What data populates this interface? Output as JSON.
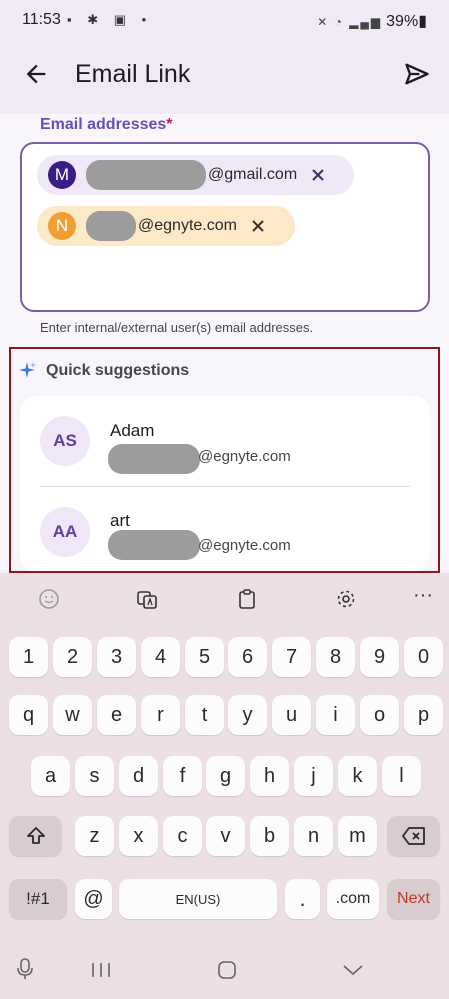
{
  "status": {
    "time": "11:53",
    "battery": "39%"
  },
  "appbar": {
    "title": "Email Link"
  },
  "field": {
    "label": "Email addresses",
    "required": "*",
    "helper": "Enter internal/external user(s) email addresses."
  },
  "chips": [
    {
      "initial": "M",
      "domain": "@gmail.com"
    },
    {
      "initial": "N",
      "domain": "@egnyte.com"
    }
  ],
  "suggestions": {
    "title": "Quick suggestions",
    "items": [
      {
        "initials": "AS",
        "name": "Adam",
        "domain": "@egnyte.com"
      },
      {
        "initials": "AA",
        "name": "art",
        "domain": "@egnyte.com"
      }
    ]
  },
  "keyboard": {
    "numbers": [
      "1",
      "2",
      "3",
      "4",
      "5",
      "6",
      "7",
      "8",
      "9",
      "0"
    ],
    "row1": [
      "q",
      "w",
      "e",
      "r",
      "t",
      "y",
      "u",
      "i",
      "o",
      "p"
    ],
    "row2": [
      "a",
      "s",
      "d",
      "f",
      "g",
      "h",
      "j",
      "k",
      "l"
    ],
    "row3": [
      "z",
      "x",
      "c",
      "v",
      "b",
      "n",
      "m"
    ],
    "sym": "!#1",
    "at": "@",
    "space": "EN(US)",
    "dot": ".",
    "dotcom": ".com",
    "next": "Next"
  },
  "colors": {
    "accent": "#6a4fb3",
    "highlight_border": "#8b1a20",
    "chip_m": "#3a1d84",
    "chip_n": "#f0a030"
  }
}
